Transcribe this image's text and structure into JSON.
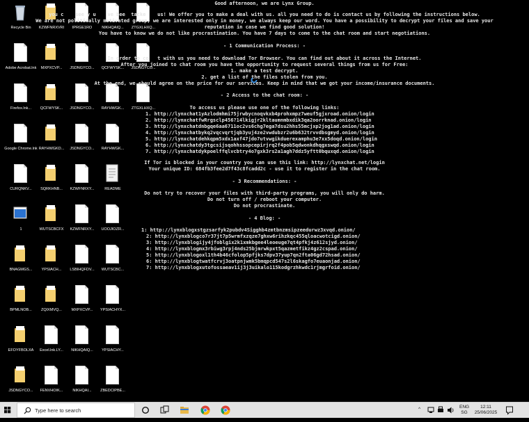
{
  "note": {
    "greeting": "Good afternoon, we are Lynx Group.",
    "intro": [
      "you c    see y u    ve bee  tacke    us! We offer you to make a deal with us. all you need to do is contact us by following the instructions below.",
      "We are not politically motivated group, we are interested only in money, we always keep our word. You have a possibility to decrypt your files and save your",
      "reputation in case we find good solution!",
      "You have to know we do not like procrastination. You have 7 days to come to the chat room and start negotiations."
    ],
    "sec1_title": "- 1 Communication Process: -",
    "sec1_lines": [
      "In order to co   t with us you need to download Tor Browser. You can find out about it across the Internet.",
      "After you joined to chat room you have the opportunity to request several things from us for Free:",
      "1. make a test decrypt.",
      "2. get a list of the files stolen from you.",
      "At the end, we should agree on the price for our services. Keep in mind that we got your income/insurance documents."
    ],
    "sec2_title": "- 2 Access to the chat room: -",
    "sec2_intro": "To access us please use one of the following links:",
    "chat_links": [
      "1. http://lynxchat1yAzlodmhmi75jrwbycnoqvkxb4prohxmpz7weuf5gjxroad.onion/login",
      "2. http://lynxchatfwRrgsclp456?14lkigjr2kltaumnmbxdik3qa2oorrknad.onion/login",
      "3. http://lynxchatdnbgqe6aa6711oc2vs6chg7ega7dsu2hhs55mcjxp2jog1ad.onion/login",
      "4. http://lynxchatbykq2vqcvqrtjqb3yuj4ze2vwdubzr2u6b632trvvdbsgmyd.onion/login",
      "5. http://lynxchatdehkqpm5xdx1axf47jdo7utvwgikduerexamphu3e7xx5doqd.onion/login",
      "6. http://lynxchatdy3tgcsijsqohhssopcepirjrq2f4pob5qdwonkdhqgxswqd.onion/login",
      "7. http://lynxchatdykpoelffqlvcbtry4o7gxk3rs2a1agh7ddz5yftt0bquxqd.onion/login"
    ],
    "tor_blocked": "If Tor is blocked in your country you can use this link: http://lynxchat.net/login",
    "unique_id": "Your unique ID: 684fb3fee2d7f43c8fcadd2c - use it to register in the chat room.",
    "sec3_title": "- 3 Recommendations: -",
    "sec3_lines": [
      "Do not try to recover your files with third-party programs, you will only do harm.",
      "Do not turn off / reboot your computer.",
      "Do not procrastinate."
    ],
    "sec4_title": "- 4 Blog: -",
    "blog_links": [
      "1: http://lynxblogxstgzsarfyk2pubdv4Sigghb4zmtbnzmsipzeedurwz3xvqd.onion/",
      "2: http://lynxblogco7r37jt7p5wrmfxzqze7ghxw6rihzkqc455qloacwotcigd.onion/",
      "3: http://lynxblogijy4jfoblgix2k1xmkbgee4leoeuge7qt4pfkj4z612sjyd.onion/",
      "4: http://lynxblogmx3rbiwg3rpj4nds25bjmrwkpxt5qazmetfikz4gz2cspad.onion/",
      "5: http://lynxblogoxl1th4b46cfolop5pfjks7dpv37yup7qn2fta06gd72hsad.onion/",
      "6: http://lynxblogtwatfcrvj3oatpnjwmk5bmqpcd547s2l6skagfo7euaonjad.onion/",
      "7: http://lynxblogxutofossaeav1ij3j3uikalo115kodgrzhkwdc1rjmgrfoid.onion/"
    ]
  },
  "desktop_icons": [
    {
      "label": "Recycle Bin",
      "kind": "recycle"
    },
    {
      "label": "KZWFNRXVRI",
      "kind": "folder"
    },
    {
      "label": "IPRGE1RO",
      "kind": "doc"
    },
    {
      "label": "NIKHQAIQ...",
      "kind": "doc"
    },
    {
      "label": "ZTGXLHXQ...",
      "kind": "doc"
    },
    {
      "label": "Adobe Acrobat.lnk",
      "kind": "doc"
    },
    {
      "label": "MXPXCVP...",
      "kind": "folder"
    },
    {
      "label": "JSDNGYCO...",
      "kind": "doc"
    },
    {
      "label": "QCFWYSK...",
      "kind": "doc"
    },
    {
      "label": "JSDNGYCO...",
      "kind": "doc"
    },
    {
      "label": "Firefox.lnk...",
      "kind": "doc"
    },
    {
      "label": "QCFWYSK...",
      "kind": "folder"
    },
    {
      "label": "JSDNGYCO...",
      "kind": "doc"
    },
    {
      "label": "RAYHWGK...",
      "kind": "doc"
    },
    {
      "label": "ZTGXLHXQ...",
      "kind": "doc"
    },
    {
      "label": "Google Chrome.lnk",
      "kind": "doc"
    },
    {
      "label": "RAYHWGKD...",
      "kind": "folder"
    },
    {
      "label": "JSDNGYCO...",
      "kind": "doc"
    },
    {
      "label": "RAYHWGK...",
      "kind": "doc"
    },
    {
      "label": "CURQNKV...",
      "kind": "doc"
    },
    {
      "label": "SQRKHNB...",
      "kind": "folder"
    },
    {
      "label": "KZWFNRXY...",
      "kind": "doc"
    },
    {
      "label": "README",
      "kind": "readme"
    },
    {
      "label": "1",
      "kind": "app"
    },
    {
      "label": "WUTSCBCFX",
      "kind": "folder"
    },
    {
      "label": "KZWFNRXY...",
      "kind": "doc"
    },
    {
      "label": "UOOJIOZR...",
      "kind": "doc"
    },
    {
      "label": "BNAGMGS...",
      "kind": "folder"
    },
    {
      "label": "YPSIACH...",
      "kind": "folder"
    },
    {
      "label": "LSBIHQFDV...",
      "kind": "doc"
    },
    {
      "label": "WUTSCBC...",
      "kind": "doc"
    },
    {
      "label": "BPMLNOB...",
      "kind": "folder"
    },
    {
      "label": "ZQIXMVQ...",
      "kind": "folder"
    },
    {
      "label": "MXPXCVP...",
      "kind": "doc"
    },
    {
      "label": "YPSIACHYX...",
      "kind": "doc"
    },
    {
      "label": "EFOYFBOLXA",
      "kind": "folder"
    },
    {
      "label": "Excel.lnk.LY...",
      "kind": "doc"
    },
    {
      "label": "NIKHQAIQ...",
      "kind": "doc"
    },
    {
      "label": "YPSIACHY...",
      "kind": "doc"
    },
    {
      "label": "JSDNGYCO...",
      "kind": "folder"
    },
    {
      "label": "FENVHOIK...",
      "kind": "doc"
    },
    {
      "label": "NIKHQAI...",
      "kind": "doc"
    },
    {
      "label": "ZBEDCIPBE...",
      "kind": "doc"
    }
  ],
  "taskbar": {
    "search_placeholder": "Type here to search",
    "lang": "ENG",
    "region": "SG",
    "time": "12:11",
    "date": "25/06/2025"
  },
  "colors": {
    "note_text": "#e6e6e6",
    "taskbar": "#e3e3e3",
    "folder": "#f4cf6f"
  }
}
